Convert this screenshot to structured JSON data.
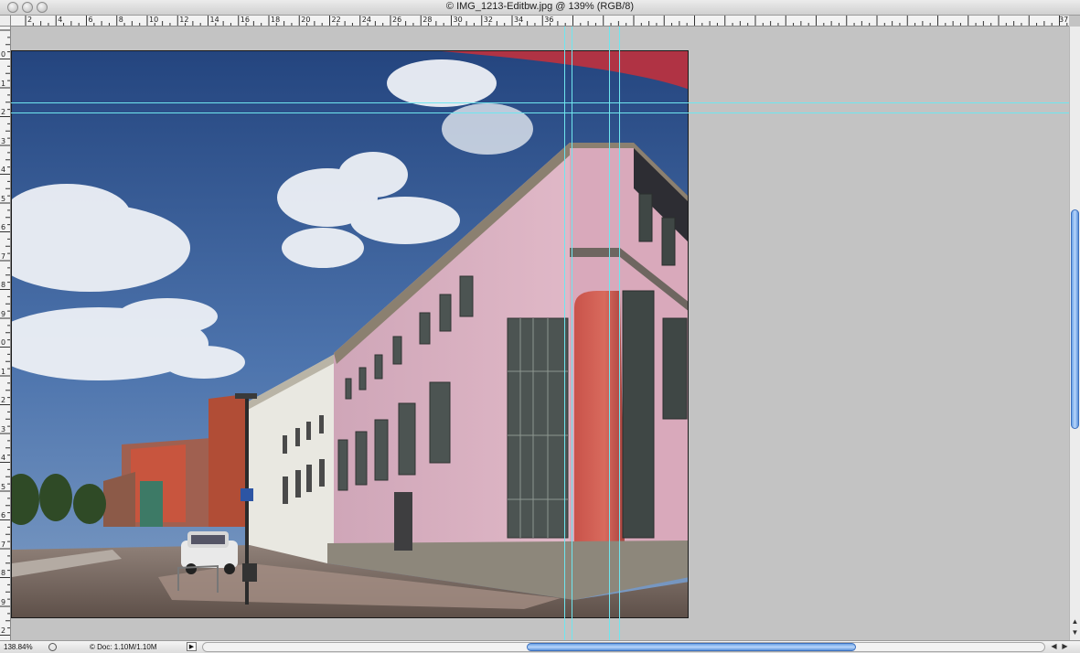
{
  "window": {
    "title": "© IMG_1213-Editbw.jpg @ 139% (RGB/8)"
  },
  "ruler": {
    "top_labels": [
      "2",
      "4",
      "6",
      "8",
      "10",
      "12",
      "14",
      "16",
      "18",
      "20",
      "22",
      "24",
      "26",
      "28",
      "30",
      "32",
      "34",
      "36",
      "37"
    ],
    "left_labels": [
      "0",
      "1",
      "2",
      "3",
      "4",
      "5",
      "6",
      "7",
      "8",
      "9",
      "0",
      "1",
      "2",
      "3",
      "4",
      "5",
      "6",
      "7",
      "8",
      "9",
      "2"
    ]
  },
  "status": {
    "zoom": "138.84%",
    "doc": "© Doc: 1.10M/1.10M",
    "menu_arrow": "▶"
  },
  "scroll": {
    "left_arrow": "◀",
    "right_arrow": "▶",
    "up_arrow": "▲",
    "down_arrow": "▼"
  },
  "icons": {
    "close": "close-button-icon",
    "minimize": "minimize-button-icon",
    "zoom": "zoom-button-icon",
    "navigator": "navigator-icon"
  },
  "colors": {
    "guide": "#6fe6ef",
    "scroll_thumb": "#6aa2e6",
    "canvas_bg": "#c3c3c3"
  }
}
